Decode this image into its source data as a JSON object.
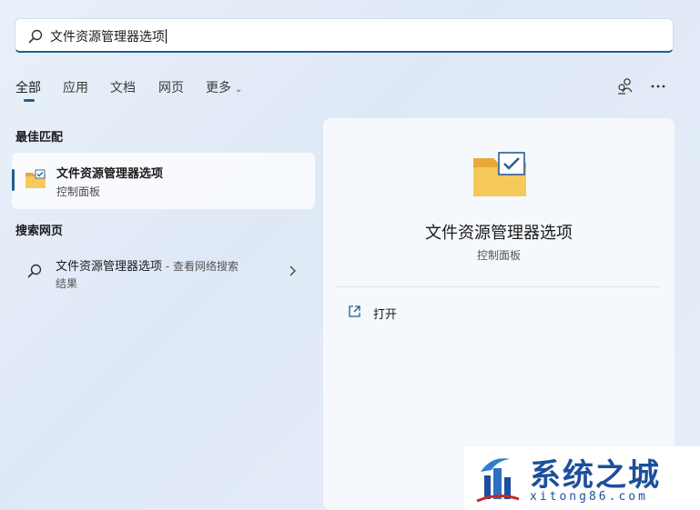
{
  "search": {
    "query": "文件资源管理器选项"
  },
  "tabs": [
    {
      "label": "全部",
      "active": true
    },
    {
      "label": "应用"
    },
    {
      "label": "文档"
    },
    {
      "label": "网页"
    },
    {
      "label": "更多"
    }
  ],
  "top_icons": [
    "people-switch-icon",
    "more-options-icon"
  ],
  "best_match": {
    "section_title": "最佳匹配",
    "title": "文件资源管理器选项",
    "subtitle": "控制面板",
    "icon": "folder-options-icon"
  },
  "web_search": {
    "section_title": "搜索网页",
    "query": "文件资源管理器选项",
    "suffix": " - 查看网络搜索",
    "line2": "结果"
  },
  "preview": {
    "title": "文件资源管理器选项",
    "subtitle": "控制面板",
    "actions": [
      {
        "label": "打开",
        "icon": "open-external-icon"
      }
    ]
  },
  "watermark": {
    "brand": "系统之城",
    "url": "xitong86.com"
  },
  "colors": {
    "accent": "#1f5f8f",
    "brand": "#1c4f9c",
    "folder": "#f6c95b"
  }
}
